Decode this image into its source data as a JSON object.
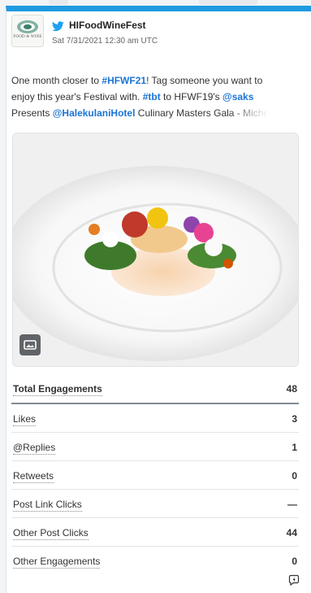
{
  "post": {
    "handle": "HIFoodWineFest",
    "timestamp": "Sat 7/31/2021 12:30 am UTC",
    "avatar_text": "FOOD & WINE",
    "text_lines": [
      [
        {
          "t": "One month closer to ",
          "s": "plain"
        },
        {
          "t": "#HFWF21",
          "s": "link"
        },
        {
          "t": "! Tag someone you want to",
          "s": "plain"
        }
      ],
      [
        {
          "t": "enjoy this year's Festival with. ",
          "s": "plain"
        },
        {
          "t": "#tbt",
          "s": "link"
        },
        {
          "t": " to HFWF19's ",
          "s": "plain"
        },
        {
          "t": "@saks",
          "s": "link"
        }
      ],
      [
        {
          "t": "Presents ",
          "s": "plain"
        },
        {
          "t": "@HalekulaniHotel",
          "s": "link"
        },
        {
          "t": " Culinary Masters Gala - Miche",
          "s": "fade"
        }
      ]
    ]
  },
  "metrics": [
    {
      "label": "Total Engagements",
      "value": "48"
    },
    {
      "label": "Likes",
      "value": "3"
    },
    {
      "label": "@Replies",
      "value": "1"
    },
    {
      "label": "Retweets",
      "value": "0"
    },
    {
      "label": "Post Link Clicks",
      "value": "—"
    },
    {
      "label": "Other Post Clicks",
      "value": "44"
    },
    {
      "label": "Other Engagements",
      "value": "0"
    }
  ],
  "icons": {
    "network": "twitter-icon",
    "media": "image-icon",
    "boost": "boost-icon"
  },
  "colors": {
    "accent_bar": "#1f9ae0",
    "twitter_blue": "#1da1f2",
    "link": "#1b74d6"
  }
}
